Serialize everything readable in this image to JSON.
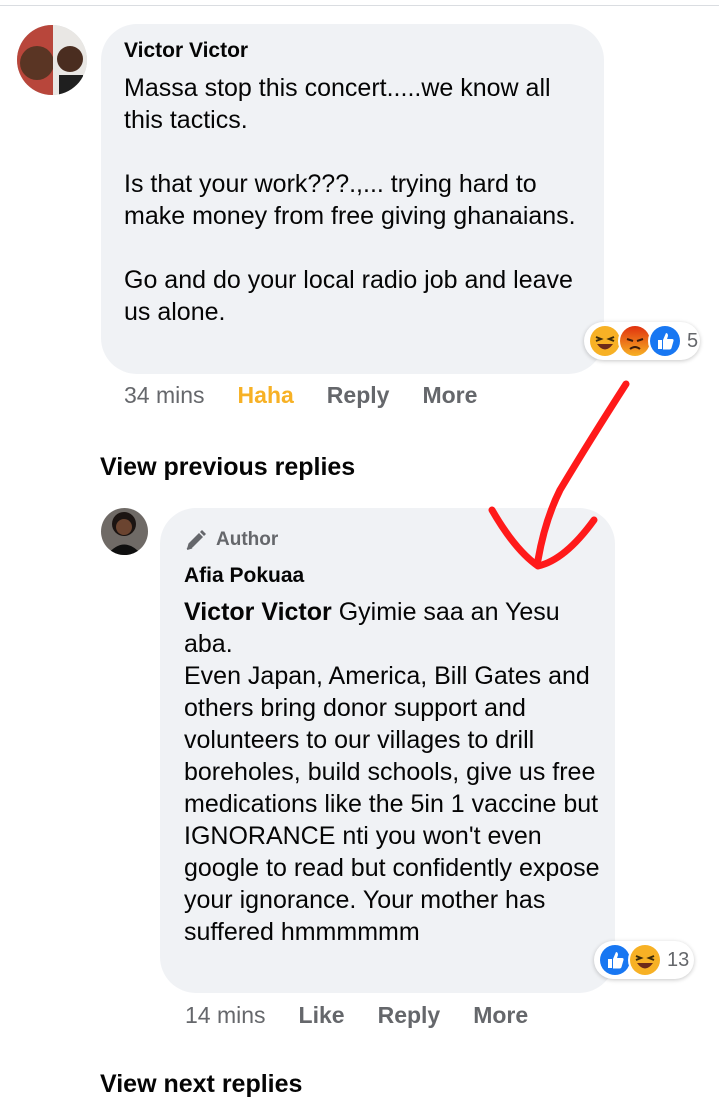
{
  "comment": {
    "author": "Victor Victor",
    "text": "Massa stop this concert.....we know all this tactics.\n\nIs that your work???.,... trying hard to make money from free giving ghanaians.\n\nGo and do your local radio job and leave us alone.",
    "reaction_count": "5",
    "time": "34 mins",
    "reaction_label": "Haha",
    "reply_label": "Reply",
    "more_label": "More"
  },
  "view_previous": "View previous replies",
  "reply": {
    "badge": "Author",
    "author": "Afia Pokuaa",
    "mention": "Victor Victor",
    "text": " Gyimie saa an Yesu aba.\nEven Japan, America, Bill Gates and others bring donor support and volunteers to our villages to drill boreholes, build schools, give us free medications like the 5in 1 vaccine but IGNORANCE nti you won't even google to read but confidently expose your ignorance. Your mother has suffered hmmmmmm",
    "reaction_count": "13",
    "time": "14 mins",
    "like_label": "Like",
    "reply_label": "Reply",
    "more_label": "More"
  },
  "view_next": "View next replies",
  "colors": {
    "bubble": "#f0f2f5",
    "meta_text": "#65676b",
    "haha": "#f7b125",
    "like_blue": "#1877f2",
    "angry": "#e9710f",
    "annotation_red": "#ff1a1a"
  },
  "icons": [
    "laugh-react-icon",
    "angry-react-icon",
    "like-react-icon",
    "pencil-icon"
  ]
}
